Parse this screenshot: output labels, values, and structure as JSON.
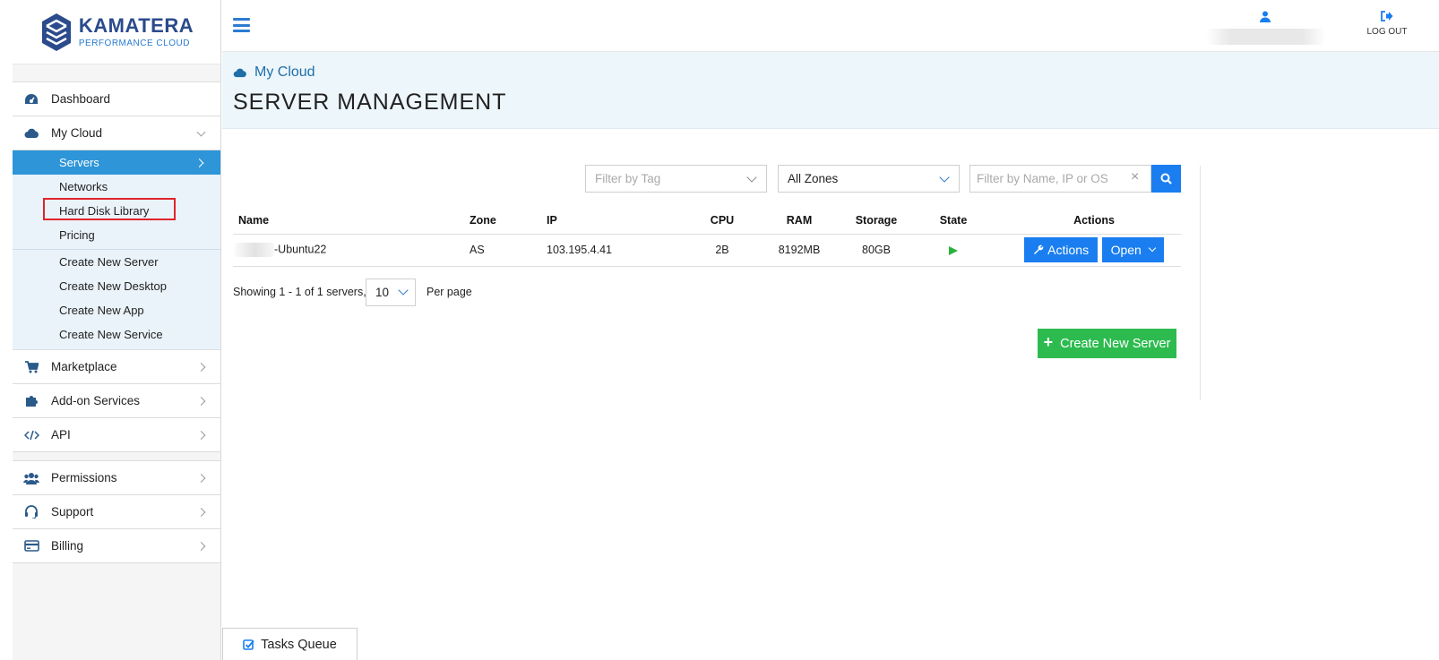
{
  "brand": {
    "name": "KAMATERA",
    "tagline": "PERFORMANCE CLOUD"
  },
  "header": {
    "logout_label": "LOG OUT"
  },
  "sidebar": {
    "items": [
      {
        "label": "Dashboard",
        "icon": "dashboard-icon"
      },
      {
        "label": "My Cloud",
        "icon": "cloud-icon"
      },
      {
        "label": "Marketplace",
        "icon": "cart-icon"
      },
      {
        "label": "Add-on Services",
        "icon": "puzzle-icon"
      },
      {
        "label": "API",
        "icon": "code-icon"
      },
      {
        "label": "Permissions",
        "icon": "users-icon"
      },
      {
        "label": "Support",
        "icon": "headset-icon"
      },
      {
        "label": "Billing",
        "icon": "credit-card-icon"
      }
    ],
    "my_cloud_submenu": [
      {
        "label": "Servers",
        "active": true
      },
      {
        "label": "Networks"
      },
      {
        "label": "Hard Disk Library",
        "highlighted": true
      },
      {
        "label": "Pricing"
      },
      {
        "label": "Create New Server"
      },
      {
        "label": "Create New Desktop"
      },
      {
        "label": "Create New App"
      },
      {
        "label": "Create New Service"
      }
    ]
  },
  "page": {
    "breadcrumb": "My Cloud",
    "title": "SERVER MANAGEMENT"
  },
  "filters": {
    "tag_placeholder": "Filter by Tag",
    "zone_value": "All Zones",
    "search_placeholder": "Filter by Name, IP or OS",
    "clear_symbol": "×"
  },
  "table": {
    "headers": [
      "Name",
      "Zone",
      "IP",
      "CPU",
      "RAM",
      "Storage",
      "State",
      "Actions"
    ],
    "rows": [
      {
        "name_suffix": "-Ubuntu22",
        "zone": "AS",
        "ip": "103.195.4.41",
        "cpu": "2B",
        "ram": "8192MB",
        "storage": "80GB",
        "state": "running"
      }
    ],
    "actions_label": "Actions",
    "open_label": "Open"
  },
  "pagination": {
    "showing": "Showing 1 - 1 of 1 servers,",
    "per_page_value": "10",
    "per_page_label": "Per page"
  },
  "create_button": {
    "label": "Create New Server"
  },
  "tasks_queue": {
    "label": "Tasks Queue"
  },
  "colors": {
    "primary_blue": "#1a7ef0",
    "sidebar_active": "#2d95d8",
    "success_green": "#2dbb4f",
    "highlight_red": "#e0242a"
  }
}
